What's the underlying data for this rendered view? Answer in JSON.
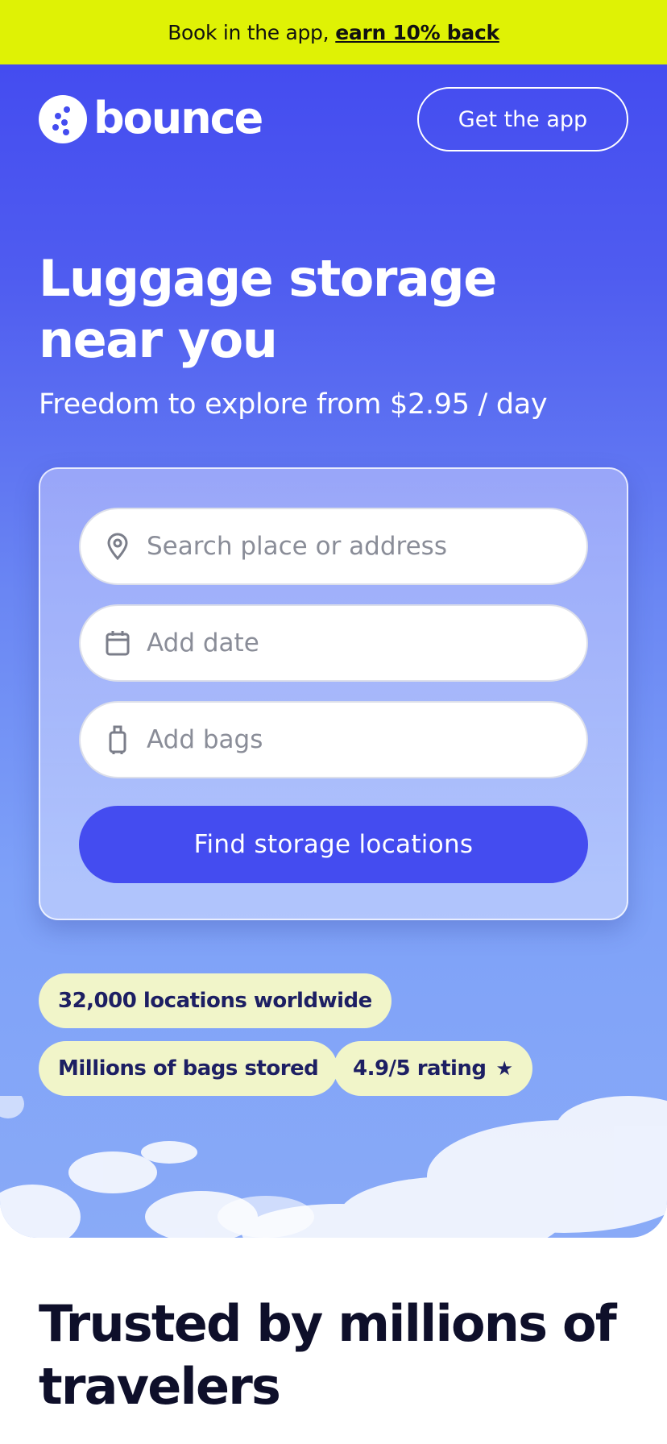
{
  "promo": {
    "text": "Book in the app,",
    "link": "earn 10% back"
  },
  "header": {
    "logo_text": "bounce",
    "logo_icon": "bounce-logo-icon",
    "cta": "Get the app"
  },
  "hero": {
    "title": "Luggage storage near you",
    "subtitle": "Freedom to explore from $2.95 / day"
  },
  "search": {
    "location": {
      "placeholder": "Search place or address",
      "icon": "location-pin-icon"
    },
    "date": {
      "placeholder": "Add date",
      "icon": "calendar-icon"
    },
    "bags": {
      "placeholder": "Add bags",
      "icon": "luggage-icon"
    },
    "submit": "Find storage locations"
  },
  "badges": {
    "locations": "32,000 locations worldwide",
    "bags": "Millions of bags stored",
    "rating": "4.9/5 rating",
    "rating_icon": "star-icon"
  },
  "trust": {
    "title": "Trusted by millions of travelers"
  },
  "colors": {
    "promo_bg": "#dff205",
    "brand_blue": "#444cf0",
    "badge_bg": "#f1f5c9",
    "badge_text": "#1d1f63",
    "heading_dark": "#0e0f2a"
  }
}
